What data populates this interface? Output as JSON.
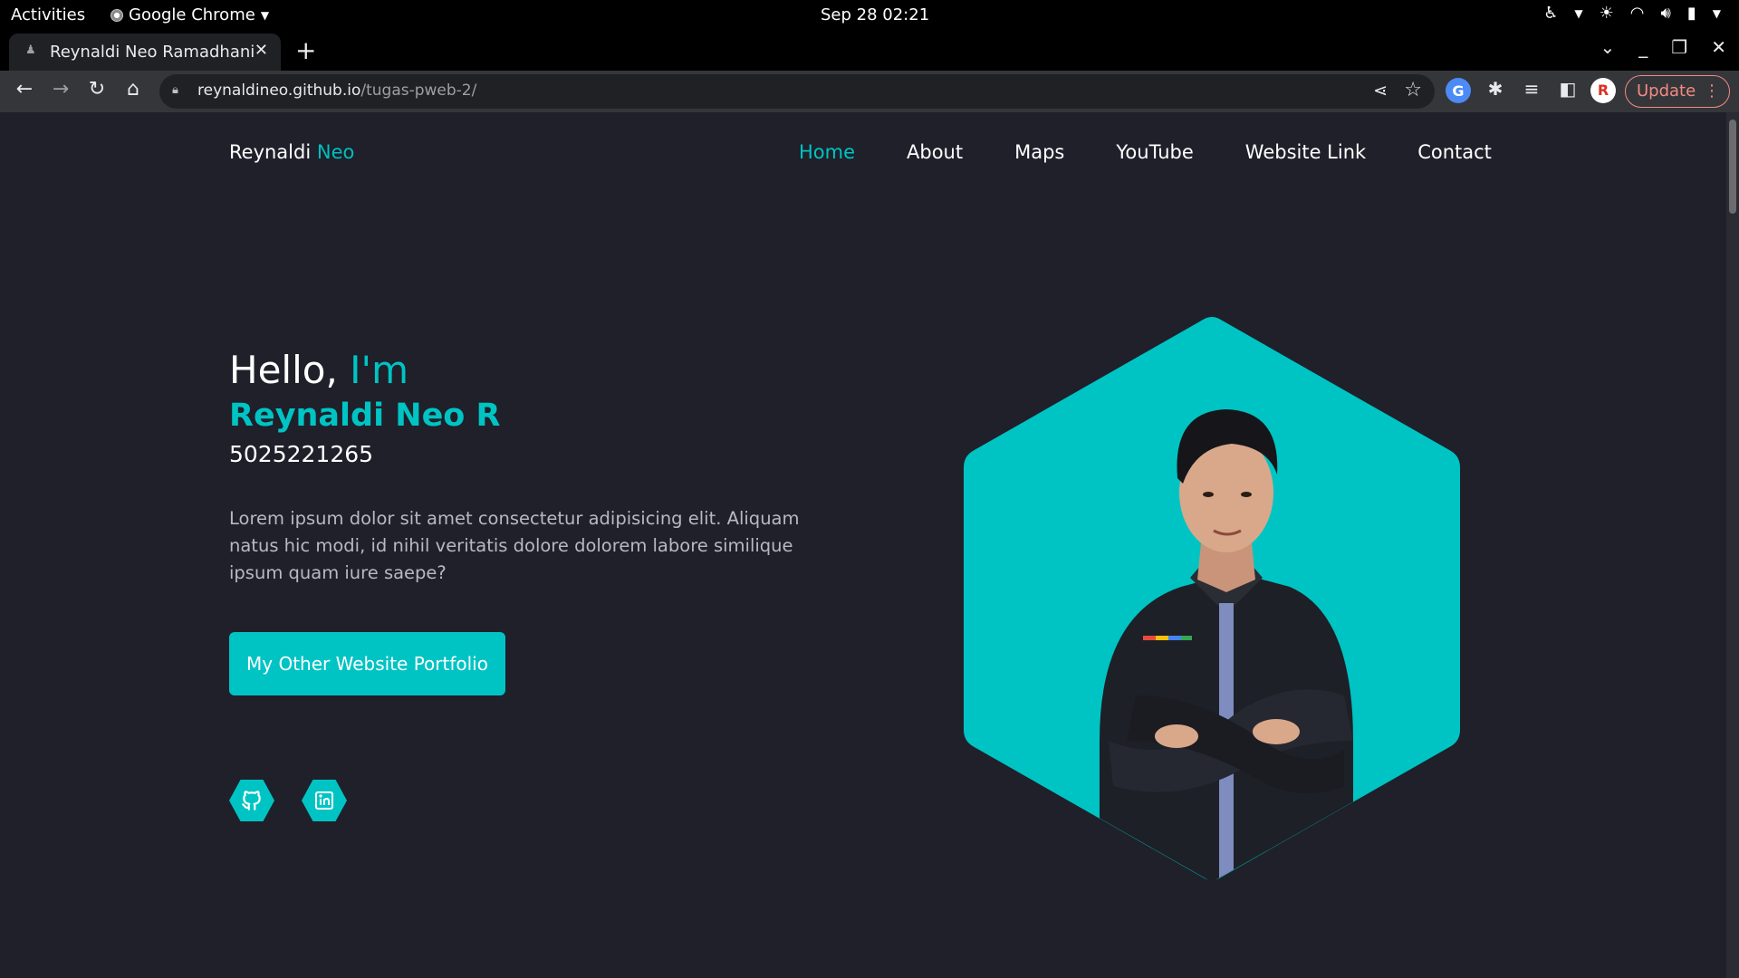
{
  "system_bar": {
    "activities": "Activities",
    "app_name": "Google Chrome",
    "clock": "Sep 28  02:21"
  },
  "browser": {
    "tab_title": "Reynaldi Neo Ramadhani",
    "url_host": "reynaldineo.github.io",
    "url_path": "/tugas-pweb-2/",
    "update_label": "Update"
  },
  "site": {
    "brand_first": "Reynaldi",
    "brand_accent": "Neo",
    "nav": [
      {
        "label": "Home"
      },
      {
        "label": "About"
      },
      {
        "label": "Maps"
      },
      {
        "label": "YouTube"
      },
      {
        "label": "Website Link"
      },
      {
        "label": "Contact"
      }
    ],
    "hero": {
      "hello": "Hello,",
      "hello_accent": "I'm",
      "name": "Reynaldi Neo R",
      "id_number": "5025221265",
      "description": "Lorem ipsum dolor sit amet consectetur adipisicing elit. Aliquam natus hic modi, id nihil veritatis dolore dolorem labore similique ipsum quam iure saepe?",
      "button_label": "My Other Website Portfolio"
    },
    "social": [
      {
        "icon": "github-icon"
      },
      {
        "icon": "linkedin-icon"
      }
    ]
  },
  "colors": {
    "accent": "#00c4c4",
    "background": "#1f202a"
  }
}
